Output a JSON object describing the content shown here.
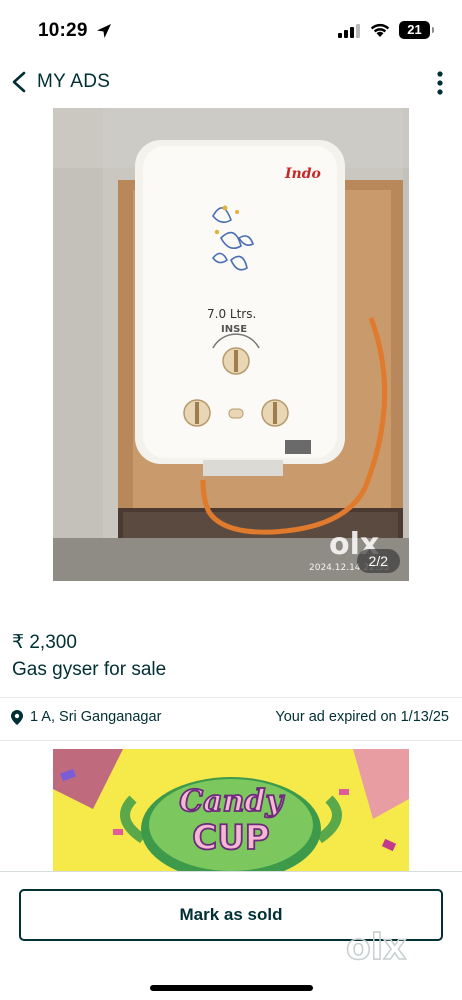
{
  "status": {
    "time": "10:29",
    "battery": "21"
  },
  "header": {
    "title": "MY ADS"
  },
  "photo": {
    "counter": "2/2",
    "device_brand": "Indo",
    "device_capacity": "7.0 Ltrs.",
    "device_model": "INSE",
    "watermark_brand": "olx",
    "watermark_date": "2024.12.14 22:55"
  },
  "ad": {
    "price": "₹ 2,300",
    "title": "Gas gyser for sale",
    "location": "1 A, Sri Ganganagar",
    "expiry": "Your ad expired on 1/13/25"
  },
  "banner": {
    "line1": "Candy",
    "line2": "CUP"
  },
  "footer": {
    "mark_sold_label": "Mark as sold",
    "watermark_brand": "olx"
  },
  "colors": {
    "brand_dark": "#002f34",
    "divider": "#e4e8ea"
  }
}
